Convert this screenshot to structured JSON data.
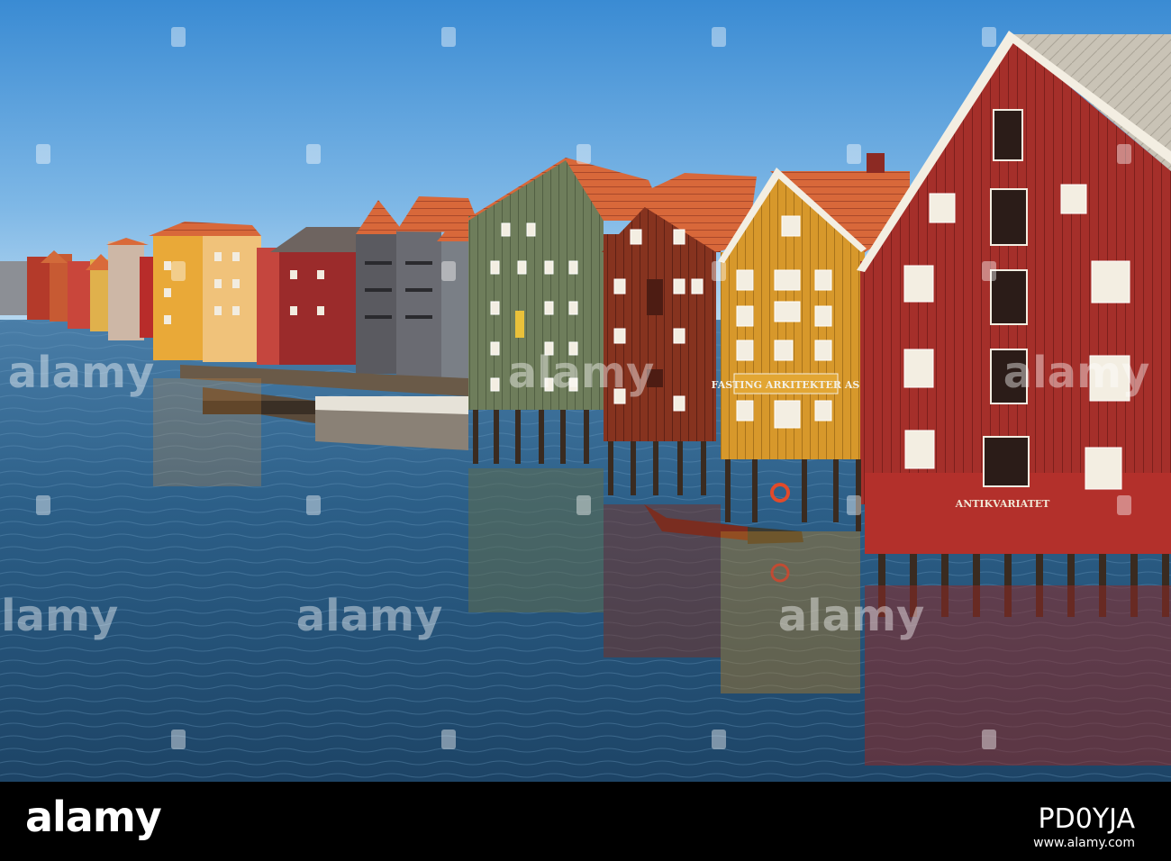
{
  "photo": {
    "signs": {
      "yellow_building": "FASTING ARKITEKTER AS",
      "red_building": "ANTIKVARIATET"
    },
    "watermark": "alamy"
  },
  "footer": {
    "logo": "alamy",
    "image_id": "PD0YJA",
    "url": "www.alamy.com"
  },
  "colors": {
    "sky_top": "#3f8fd6",
    "sky_bottom": "#c9e3f5",
    "water": "#2a5a80",
    "red_building": "#a8302b",
    "yellow_building": "#d99a2a",
    "brown_building": "#8a3427",
    "green_building": "#6f7f5e",
    "roof": "#d96a3a",
    "footer_bg": "#000000"
  }
}
